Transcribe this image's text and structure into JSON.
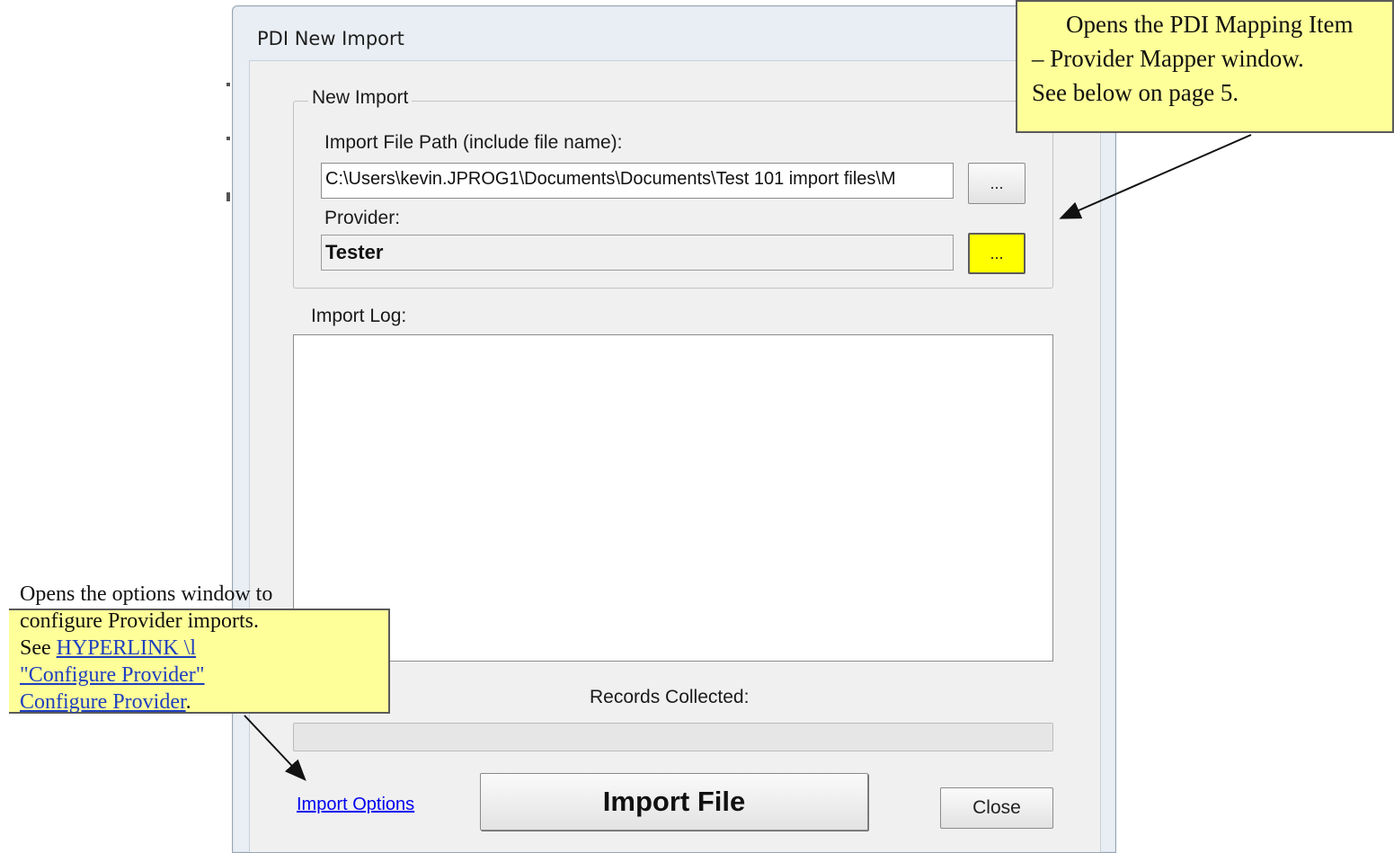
{
  "window": {
    "title": "PDI New Import"
  },
  "new_import": {
    "group_label": "New Import",
    "file_path_label": "Import File Path (include file name):",
    "file_path_value": "C:\\Users\\kevin.JPROG1\\Documents\\Documents\\Test 101 import files\\M",
    "browse_button_label": "...",
    "provider_label": "Provider:",
    "provider_value": "Tester",
    "provider_mapper_button_label": "..."
  },
  "import_log": {
    "label": "Import Log:",
    "content": ""
  },
  "records": {
    "label": "Records Collected:",
    "progress": 0
  },
  "footer": {
    "import_options_link": "Import Options",
    "import_file_button": "Import File",
    "close_button": "Close"
  },
  "callouts": {
    "mapper": {
      "line1": "Opens the PDI Mapping Item",
      "line2": "– Provider Mapper window.",
      "line3": "See below on page 5."
    },
    "options": {
      "line1": "Opens the options window to",
      "line2": "configure Provider imports.",
      "see_prefix": "See",
      "hyperlink_line1": "HYPERLINK  \\l",
      "hyperlink_line2": "\"Configure  Provider\"",
      "hyperlink_line3": "Configure Provider",
      "suffix": "."
    }
  },
  "colors": {
    "callout_bg": "#ffff99",
    "highlight_button": "#ffff00",
    "link": "#0000ee"
  }
}
